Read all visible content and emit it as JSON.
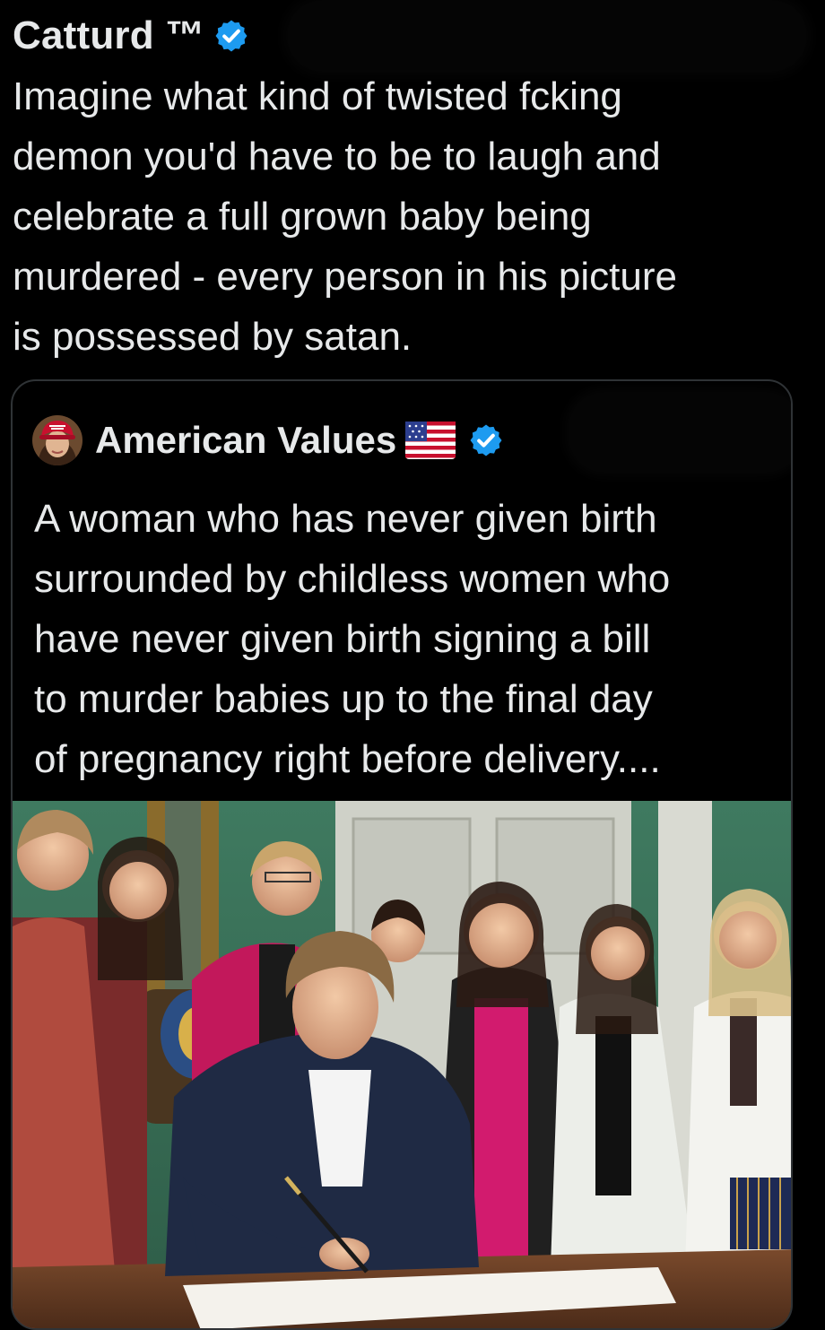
{
  "tweet": {
    "author_name": "Catturd ™",
    "verified_icon": "verified-badge-icon",
    "text": "Imagine what kind of twisted fcking\ndemon you'd have to be to laugh and\ncelebrate a full grown baby being\nmurdered - every person in his picture\nis possessed by satan."
  },
  "quote": {
    "author_name": "American Values",
    "flag_icon": "us-flag-icon",
    "verified_icon": "verified-badge-icon",
    "text": "A woman who has never given birth\nsurrounded by childless women who\nhave never given birth signing a bill\nto murder babies up to the final day\nof pregnancy right before delivery....",
    "media": {
      "kind": "photo"
    }
  },
  "colors": {
    "background": "#000000",
    "text": "#e7e9ea",
    "verified_blue": "#1d9bf0",
    "card_border": "#2f3336"
  }
}
